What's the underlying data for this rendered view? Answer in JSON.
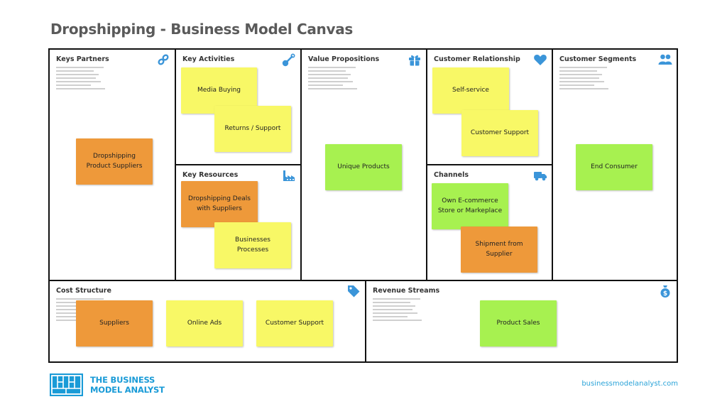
{
  "title": "Dropshipping - Business Model Canvas",
  "colors": {
    "icon": "#3b95d9",
    "yellow_note": "#f8f866",
    "orange_note": "#ee993a",
    "green_note": "#a7f150",
    "brand": "#1a9bd7"
  },
  "blocks": {
    "key_partners": {
      "title": "Keys Partners",
      "icon": "link-icon",
      "notes": [
        {
          "text": "Dropshipping Product Suppliers",
          "color": "orange"
        }
      ]
    },
    "key_activities": {
      "title": "Key Activities",
      "icon": "wrench-icon",
      "notes": [
        {
          "text": "Media Buying",
          "color": "yellow"
        },
        {
          "text": "Returns / Support",
          "color": "yellow"
        }
      ]
    },
    "key_resources": {
      "title": "Key Resources",
      "icon": "factory-icon",
      "notes": [
        {
          "text": "Dropshipping Deals with Suppliers",
          "color": "orange"
        },
        {
          "text": "Businesses Processes",
          "color": "yellow"
        }
      ]
    },
    "value_propositions": {
      "title": "Value Propositions",
      "icon": "gift-icon",
      "notes": [
        {
          "text": "Unique Products",
          "color": "green"
        }
      ]
    },
    "customer_relationship": {
      "title": "Customer Relationship",
      "icon": "heart-icon",
      "notes": [
        {
          "text": "Self-service",
          "color": "yellow"
        },
        {
          "text": "Customer Support",
          "color": "yellow"
        }
      ]
    },
    "channels": {
      "title": "Channels",
      "icon": "truck-icon",
      "notes": [
        {
          "text": "Own E-commerce Store or Markeplace",
          "color": "green"
        },
        {
          "text": "Shipment from Supplier",
          "color": "orange"
        }
      ]
    },
    "customer_segments": {
      "title": "Customer Segments",
      "icon": "users-icon",
      "notes": [
        {
          "text": "End Consumer",
          "color": "green"
        }
      ]
    },
    "cost_structure": {
      "title": "Cost Structure",
      "icon": "tag-icon",
      "notes": [
        {
          "text": "Suppliers",
          "color": "orange"
        },
        {
          "text": "Online Ads",
          "color": "yellow"
        },
        {
          "text": "Customer Support",
          "color": "yellow"
        }
      ]
    },
    "revenue_streams": {
      "title": "Revenue Streams",
      "icon": "money-bag-icon",
      "notes": [
        {
          "text": "Product Sales",
          "color": "green"
        }
      ]
    }
  },
  "footer": {
    "logo_line1": "THE BUSINESS",
    "logo_line2": "MODEL ANALYST",
    "url": "businessmodelanalyst.com"
  }
}
